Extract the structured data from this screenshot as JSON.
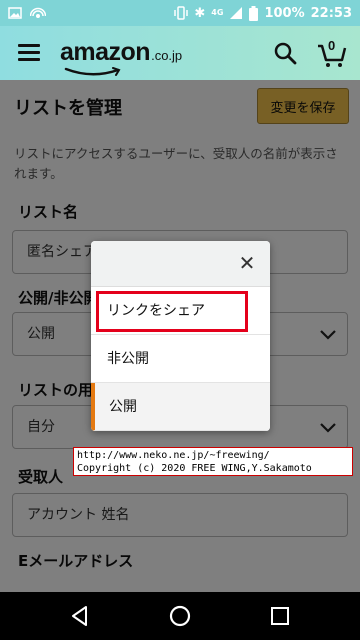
{
  "status_bar": {
    "network": "4G",
    "battery": "100%",
    "time": "22:53",
    "icons": [
      "image-icon",
      "wifi-hotspot-icon",
      "vibrate-icon",
      "bluetooth-icon",
      "signal-icon",
      "battery-icon"
    ]
  },
  "header": {
    "logo_text": "amazon",
    "logo_tld": ".co.jp",
    "cart_count": "0",
    "colors": {
      "bar_start": "#8fdde0",
      "bar_end": "#a8e6cf"
    }
  },
  "page": {
    "title": "リストを管理",
    "save_label": "変更を保存",
    "description": "リストにアクセスするユーザーに、受取人の名前が表示されます。",
    "list_name_label": "リスト名",
    "list_name_value": "匿名シェア",
    "visibility_label": "公開/非公開",
    "visibility_value": "公開",
    "purpose_label": "リストの用途",
    "purpose_value": "自分",
    "recipient_label": "受取人",
    "recipient_placeholder": "アカウント 姓名",
    "email_label": "Eメールアドレス"
  },
  "popover": {
    "items": [
      "リンクをシェア",
      "非公開",
      "公開"
    ],
    "selected": "公開",
    "accent_color": "#e47911",
    "highlight_color": "#e4001b"
  },
  "watermark": {
    "line1": "http://www.neko.ne.jp/~freewing/",
    "line2": "Copyright (c) 2020 FREE WING,Y.Sakamoto"
  }
}
